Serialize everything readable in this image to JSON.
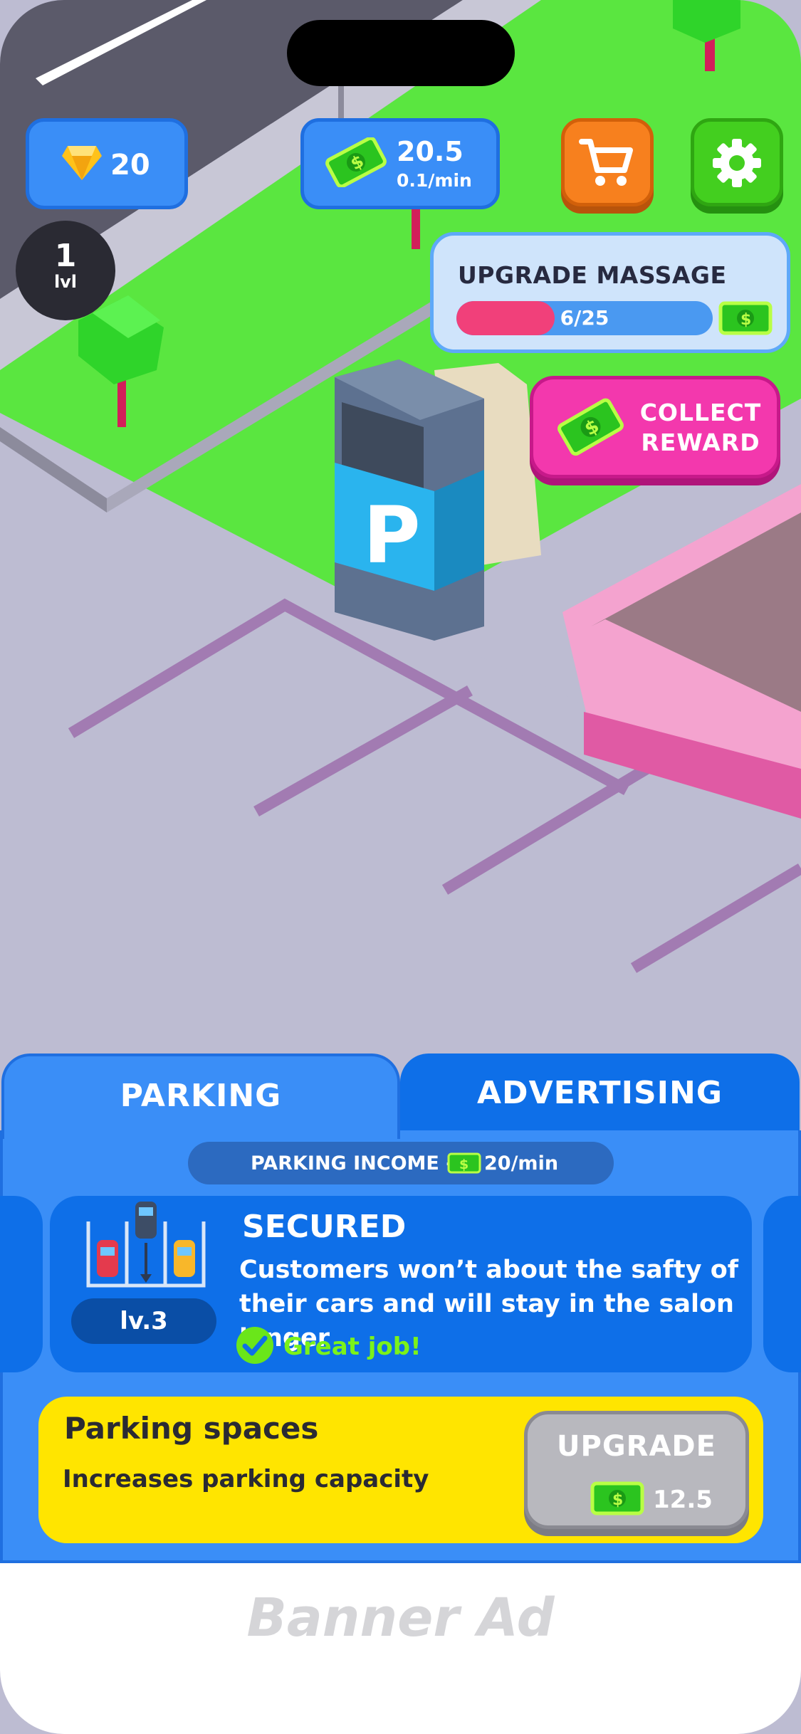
{
  "hud": {
    "gems": "20",
    "money": "20.5",
    "money_rate": "0.1/min",
    "level_number": "1",
    "level_label": "lvl"
  },
  "upgrade_task": {
    "title": "UPGRADE MASSAGE",
    "progress_text": "6/25",
    "progress_fraction": 0.24
  },
  "collect_button": {
    "line1": "COLLECT",
    "line2": "REWARD"
  },
  "scene": {
    "sign_letter": "P"
  },
  "tabs": [
    {
      "label": "PARKING",
      "active": true
    },
    {
      "label": "ADVERTISING",
      "active": false
    }
  ],
  "income": {
    "label": "PARKING INCOME -",
    "value": "20/min"
  },
  "feature": {
    "title": "SECURED",
    "description": "Customers won’t about the safty of their cars and will stay in the salon longer",
    "level": "lv.3",
    "status": "Great job!"
  },
  "upgrade_item": {
    "title": "Parking spaces",
    "description": "Increases parking capacity",
    "button_label": "UPGRADE",
    "price": "12.5"
  },
  "ad": {
    "label": "Banner Ad"
  },
  "colors": {
    "panel_blue": "#3a8ef7",
    "dark_blue": "#0e6fe8",
    "pink": "#f338ad",
    "green": "#43cf1f",
    "orange": "#f7801e",
    "yellow": "#ffe500"
  },
  "icons": [
    "gem-icon",
    "cash-icon",
    "cart-icon",
    "gear-icon",
    "parking-lot-icon",
    "check-icon"
  ]
}
